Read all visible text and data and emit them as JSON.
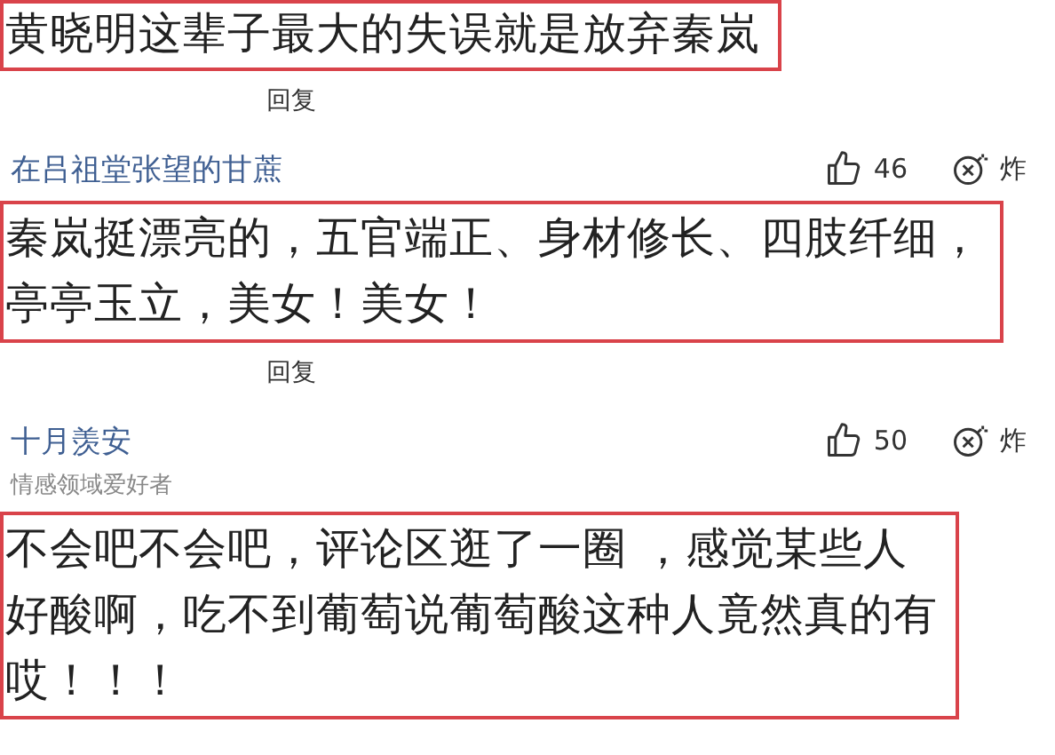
{
  "entries": [
    {
      "kind": "text",
      "lines": [
        "黄晓明这辈子最大的失误就是放弃秦岚"
      ]
    },
    {
      "kind": "reply",
      "label": "回复"
    },
    {
      "kind": "author",
      "name": "在吕祖堂张望的甘蔗",
      "likes": "46",
      "bomb": "炸"
    },
    {
      "kind": "text",
      "lines": [
        "秦岚挺漂亮的，五官端正、身材修长、四肢纤细，",
        "亭亭玉立，美女！美女！"
      ]
    },
    {
      "kind": "reply",
      "label": "回复"
    },
    {
      "kind": "author",
      "name": "十月羡安",
      "subtitle": "情感领域爱好者",
      "likes": "50",
      "bomb": "炸"
    },
    {
      "kind": "text",
      "lines": [
        "不会吧不会吧，评论区逛了一圈 ，感觉某些人",
        "好酸啊，吃不到葡萄说葡萄酸这种人竟然真的有",
        "哎！！！"
      ]
    }
  ]
}
